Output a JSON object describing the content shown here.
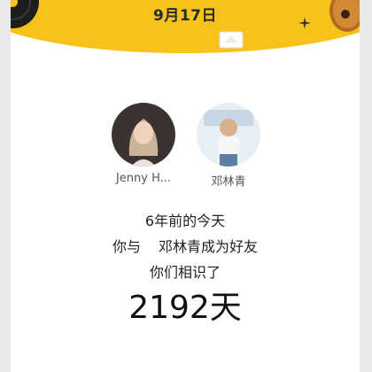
{
  "header": {
    "date": "9月17日",
    "accent_color": "#f7c31a"
  },
  "friends": [
    {
      "name": "Jenny H...",
      "avatar_icon": "user-photo-icon"
    },
    {
      "name": "邓林青",
      "avatar_icon": "user-photo-icon"
    }
  ],
  "memory": {
    "years_ago": "6年前的今天",
    "line_prefix": "你与",
    "line_rest": "邓林青成为好友",
    "known_label": "你们相识了",
    "days": "2192天"
  }
}
